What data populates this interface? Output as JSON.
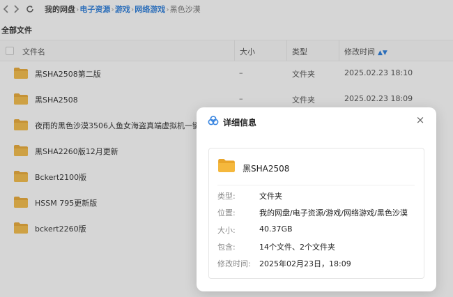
{
  "topbar": {
    "breadcrumbs": [
      "我的网盘",
      "电子资源",
      "游戏",
      "网络游戏",
      "黑色沙漠"
    ],
    "separator": "›"
  },
  "section_title": "全部文件",
  "table": {
    "columns": {
      "name": "文件名",
      "size": "大小",
      "type": "类型",
      "modified": "修改时间"
    },
    "rows": [
      {
        "name": "黑SHA2508第二版",
        "size": "–",
        "type": "文件夹",
        "date": "2025.02.23 18:10"
      },
      {
        "name": "黑SHA2508",
        "size": "–",
        "type": "文件夹",
        "date": "2025.02.23 18:09"
      },
      {
        "name": "夜雨的黑色沙漠3506人鱼女海盗真端虚拟机一键端",
        "size": "",
        "type": "",
        "date": ""
      },
      {
        "name": "黑SHA2260版12月更新",
        "size": "",
        "type": "",
        "date": ""
      },
      {
        "name": "Bckert2100版",
        "size": "",
        "type": "",
        "date": ""
      },
      {
        "name": "HSSM 795更新版",
        "size": "",
        "type": "",
        "date": ""
      },
      {
        "name": "bckert2260版",
        "size": "",
        "type": "",
        "date": ""
      }
    ]
  },
  "modal": {
    "title": "详细信息",
    "close_label": "×",
    "file_name": "黑SHA2508",
    "details": [
      {
        "key": "类型:",
        "value": "文件夹"
      },
      {
        "key": "位置:",
        "value": "我的网盘/电子资源/游戏/网络游戏/黑色沙漠"
      },
      {
        "key": "大小:",
        "value": "40.37GB"
      },
      {
        "key": "包含:",
        "value": "14个文件、2个文件夹"
      },
      {
        "key": "修改时间:",
        "value": "2025年02月23日，18:09"
      }
    ]
  },
  "colors": {
    "accent": "#1a73d9",
    "folder": "#f5b83d",
    "folder_dark": "#e9a52a"
  },
  "icons": [
    "back-icon",
    "forward-icon",
    "refresh-icon",
    "folder-icon",
    "sort-icon",
    "detail-info-icon",
    "close-icon"
  ]
}
